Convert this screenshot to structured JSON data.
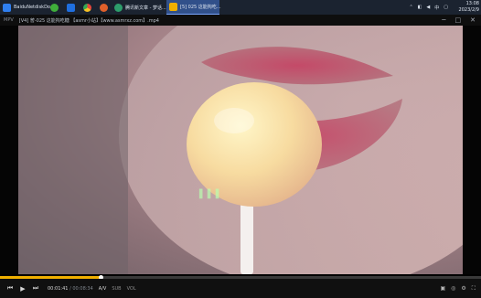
{
  "taskbar": {
    "items": [
      {
        "label": "BaiduNetdiskDo...",
        "color": "#2f7ff0"
      },
      {
        "label": "",
        "color": "#3fae3a"
      },
      {
        "label": "",
        "color": "#1f6fe0"
      },
      {
        "label": "",
        "color": "#e8b12a"
      },
      {
        "label": "",
        "color": "#e0602a"
      },
      {
        "label": "腾讯新文章 - 梦话...",
        "color": "#2d9d6b"
      },
      {
        "label": "[5] 025 这能掏吃...",
        "color": "#f0b000"
      }
    ],
    "tray": [
      "中"
    ],
    "clock_time": "13:08",
    "clock_date": "2023/2/9"
  },
  "player": {
    "brand": "MPV",
    "file_title": "[V4] 蒈-025 这能掏吃糖 【asmr小站】【www.asmrxz.com】.mp4",
    "window_buttons": [
      "─",
      "□",
      "✕"
    ]
  },
  "video": {
    "watermark": "▌▌▌"
  },
  "controls": {
    "progress": 0.21,
    "time_current": "00:01:41",
    "time_total": "/ 00:08:34",
    "tags": [
      "A/V",
      "SUB",
      "VOL"
    ],
    "right_buttons": [
      "▣",
      "◎",
      "⚙",
      "⛶"
    ]
  }
}
